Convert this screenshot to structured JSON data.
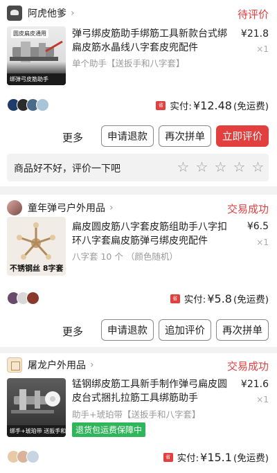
{
  "orders": [
    {
      "shop": {
        "name": "阿虎他爹"
      },
      "status": "待评价",
      "product": {
        "image_top_text": "圆皮扁皮通用",
        "image_caption": "绑弹弓皮筋助手",
        "title": "弹弓绑皮筋助手绑筋工具新款台式绑扁皮筋水晶线八字套皮兜配件",
        "spec": "单个助手【送扳手和八字套】",
        "price": "¥21.8",
        "quantity": "×1"
      },
      "payment": {
        "label": "实付:",
        "amount": "¥12.48",
        "note": "(免运费)",
        "icon_text": "省"
      },
      "buttons": {
        "more": "更多",
        "refund": "申请退款",
        "rebuy": "再次拼单",
        "review": "立即评价"
      },
      "review": {
        "prompt": "商品好不好，评价一下吧",
        "star": "☆"
      }
    },
    {
      "shop": {
        "name": "童年弹弓户外用品"
      },
      "status": "交易成功",
      "product": {
        "image_caption": "不锈钢丝 8字套",
        "title": "扁皮圆皮筋八字套皮筋组助手八字扣环八字套扁皮筋弹弓绑皮兜配件",
        "spec": "八字套 10 个 （颜色随机）",
        "price": "¥6.5",
        "quantity": "×1"
      },
      "payment": {
        "label": "实付:",
        "amount": "¥5.8",
        "note": "(免运费)",
        "icon_text": "省"
      },
      "buttons": {
        "more": "更多",
        "refund": "申请退款",
        "add_review": "追加评价",
        "rebuy": "再次拼单"
      }
    },
    {
      "shop": {
        "name": "屠龙户外用品"
      },
      "status": "交易成功",
      "product": {
        "image_caption": "绑手+琥珀带 送扳手和八字套",
        "title": "锰钢绑皮筋工具新手制作弹弓扁皮圆皮台式捆扎拉筋工具绑筋助手",
        "spec": "助手+琥珀带【送扳手和八字套】",
        "promo": "退货包运费保障中",
        "price": "¥21.6",
        "quantity": "×1"
      },
      "payment": {
        "label": "实付:",
        "amount": "¥15.1",
        "note": "(免运费)",
        "icon_text": "省"
      }
    }
  ],
  "ui": {
    "chevron": "›"
  }
}
